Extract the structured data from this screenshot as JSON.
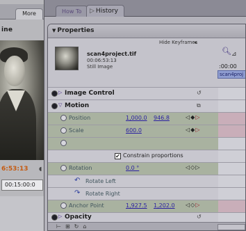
{
  "left_panel": {
    "tab_label": "More",
    "clip_name_partial": "ine",
    "timecode": "6:53:13",
    "duration": "00:15:00:0"
  },
  "tabs": {
    "how_to": "How To",
    "history": "History"
  },
  "properties": {
    "title": "Properties",
    "hide_keyframes": "Hide Keyframes",
    "clip": {
      "filename": "scan4project.tif",
      "duration": "00:06:53:13",
      "type": "Still Image"
    },
    "timeline": {
      "timecode": ":00:00",
      "clip_label": "scan4proj"
    },
    "sections": {
      "image_control": "Image Control",
      "motion": "Motion",
      "opacity": "Opacity"
    },
    "motion": {
      "position_label": "Position",
      "position_x": "1,000.0",
      "position_y": "946.8",
      "scale_label": "Scale",
      "scale_value": "600.0",
      "constrain_label": "Constrain proportions",
      "rotation_label": "Rotation",
      "rotation_value": "0.0 °",
      "rotate_left": "Rotate Left",
      "rotate_right": "Rotate Right",
      "anchor_label": "Anchor Point",
      "anchor_x": "1,927.5",
      "anchor_y": "1,202.0"
    }
  },
  "colors": {
    "background": "#6f8f39",
    "panel": "#c4c3cb",
    "value_link": "#2a1fa2",
    "keyframe_arrow": "#9b1f2c"
  }
}
